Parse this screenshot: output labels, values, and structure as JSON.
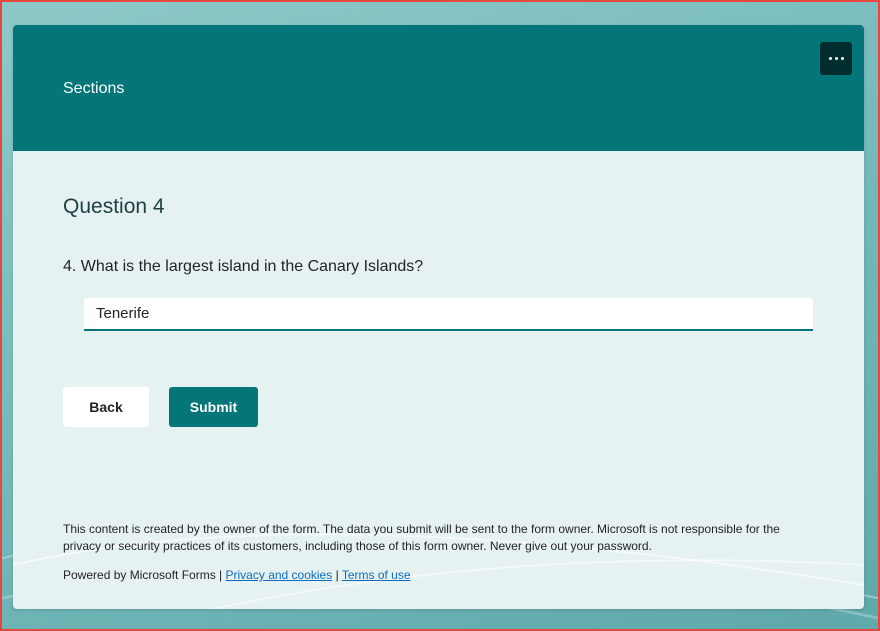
{
  "header": {
    "title": "Sections",
    "more_label": "More options"
  },
  "section": {
    "title": "Question 4"
  },
  "question": {
    "text": "4. What is the largest island in the Canary Islands?",
    "answer": "Tenerife"
  },
  "buttons": {
    "back": "Back",
    "submit": "Submit"
  },
  "footer": {
    "disclaimer": "This content is created by the owner of the form. The data you submit will be sent to the form owner. Microsoft is not responsible for the privacy or security practices of its customers, including those of this form owner. Never give out your password.",
    "powered_by": "Powered by Microsoft Forms |",
    "separator": "|",
    "privacy_link": "Privacy and cookies",
    "terms_link": "Terms of use"
  },
  "colors": {
    "accent": "#04767a",
    "more_button": "#032e30",
    "link": "#0f6cbd"
  }
}
